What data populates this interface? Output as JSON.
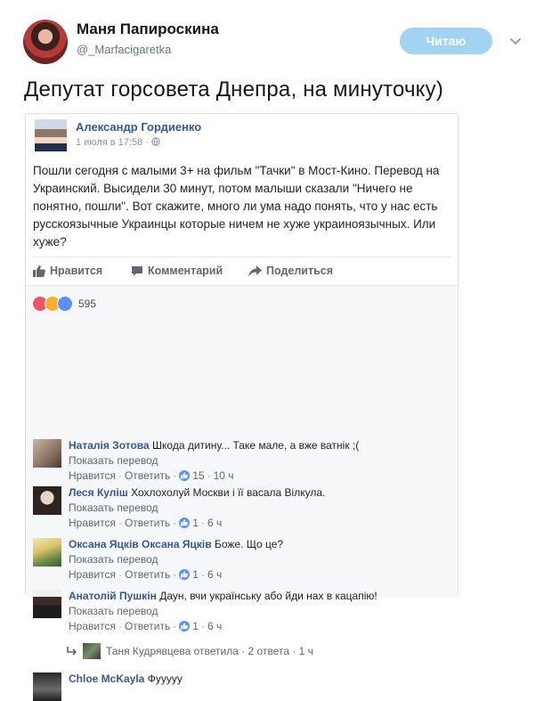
{
  "tweet": {
    "author_name": "Маня Папироскина",
    "author_handle": "@_Marfacigaretka",
    "follow_label": "Читаю",
    "text": "Депутат горсовета Днепра, на минуточку)"
  },
  "fb_post": {
    "author": "Александр Гордиенко",
    "meta": "1 июля в 17:58 · ",
    "body": "Пошли сегодня с малыми 3+ на фильм \"Тачки\" в Мост-Кино. Перевод на Украинский. Высидели 30 минут, потом малыши сказали \"Ничего не понятно, пошли\". Вот скажите, много ли ума надо понять, что у нас есть русскоязычные Украинцы которые ничем не хуже украиноязычных. Или хуже?",
    "actions": {
      "like": "Нравится",
      "comment": "Комментарий",
      "share": "Поделиться"
    },
    "reactions_count": "595",
    "reaction_colors": [
      "#f25268",
      "#f7b125",
      "#5890ff"
    ]
  },
  "comments": [
    {
      "author": "Наталія Зотова",
      "text": " Шкода дитину... Таке мале, а вже ватнік ;(",
      "translate": "Показать перевод",
      "like": "Нравится",
      "reply": "Ответить",
      "likes": "15",
      "time": "10 ч"
    },
    {
      "author": "Леся Куліш",
      "text": " Хохлохолуй Москви і її васала Вілкула.",
      "translate": "Показать перевод",
      "like": "Нравится",
      "reply": "Ответить",
      "likes": "1",
      "time": "6 ч"
    },
    {
      "author": "Оксана Яцків Оксана Яцків",
      "text": " Боже. Що це?",
      "translate": "Показать перевод",
      "like": "Нравится",
      "reply": "Ответить",
      "likes": "1",
      "time": "6 ч"
    },
    {
      "author": "Анатолій Пушкін",
      "text": " Даун, вчи українську або йди нах в кацапію!",
      "translate": "Показать перевод",
      "like": "Нравится",
      "reply": "Ответить",
      "likes": "1",
      "time": "6 ч",
      "reply_preview": {
        "text": "Таня Кудрявцева ответила · 2 ответа · 1 ч"
      }
    },
    {
      "author": "Chloe McKayla",
      "text": " Фууууу"
    }
  ],
  "ui_dots": {
    "sep": "·"
  }
}
